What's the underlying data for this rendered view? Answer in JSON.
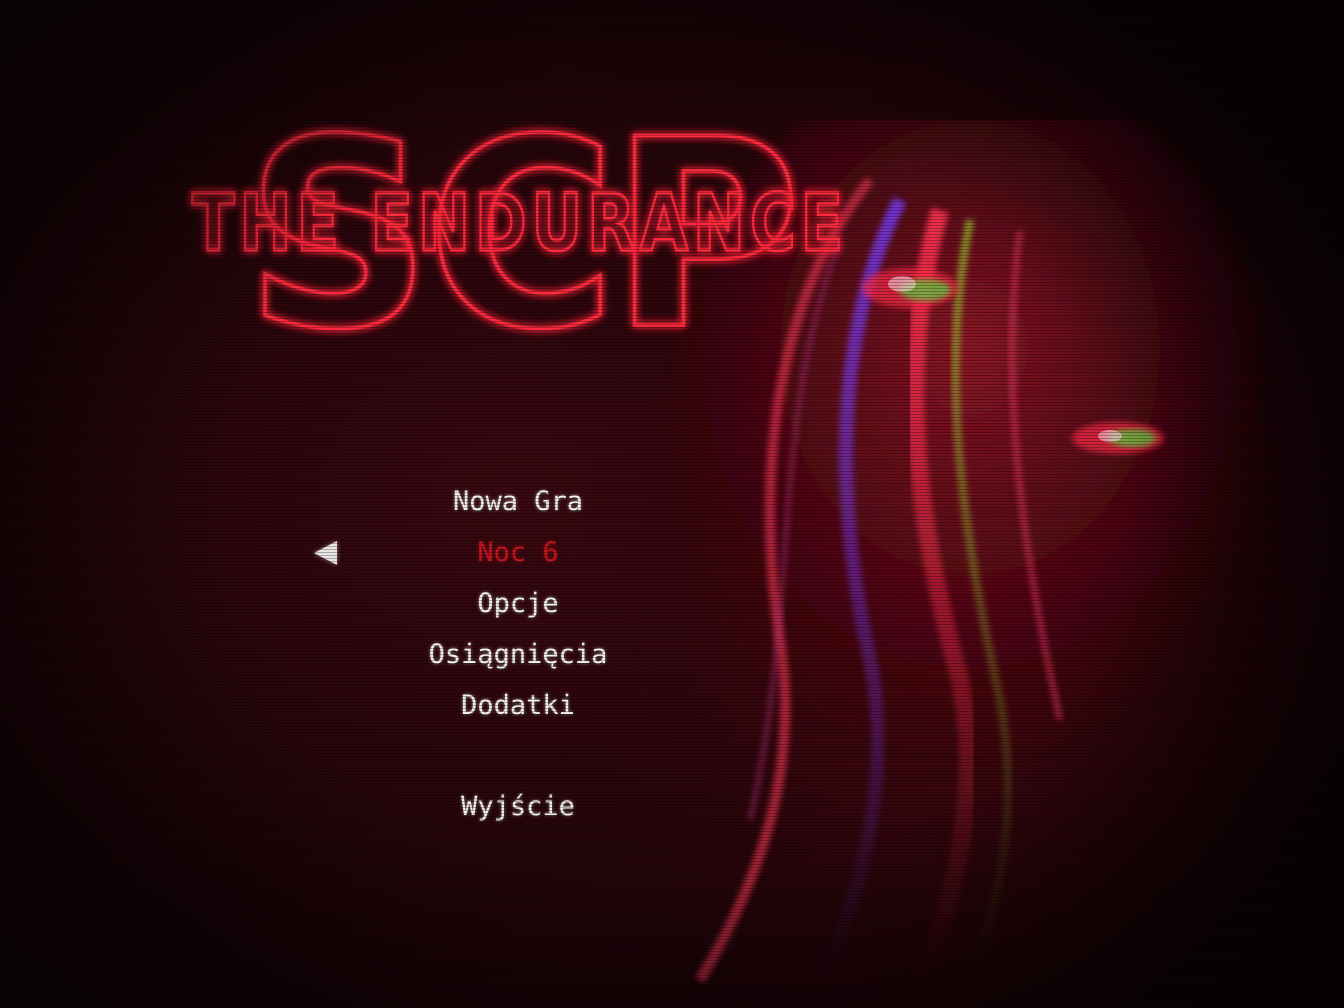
{
  "game": {
    "logo_main": "SCP",
    "logo_sub": "THE ENDURANCE"
  },
  "menu": {
    "items": [
      {
        "label": "Nowa Gra",
        "selected": false
      },
      {
        "label": "Noc 6",
        "selected": true
      },
      {
        "label": "Opcje",
        "selected": false
      },
      {
        "label": "Osiągnięcia",
        "selected": false
      },
      {
        "label": "Dodatki",
        "selected": false
      },
      {
        "label": "Wyjście",
        "selected": false
      }
    ]
  },
  "selector_icon": "triangle-left-icon",
  "colors": {
    "neon": "#ff2a3c",
    "menu_text": "#f4f0ee",
    "menu_selected": "#c4161e",
    "background": "#25050a"
  }
}
